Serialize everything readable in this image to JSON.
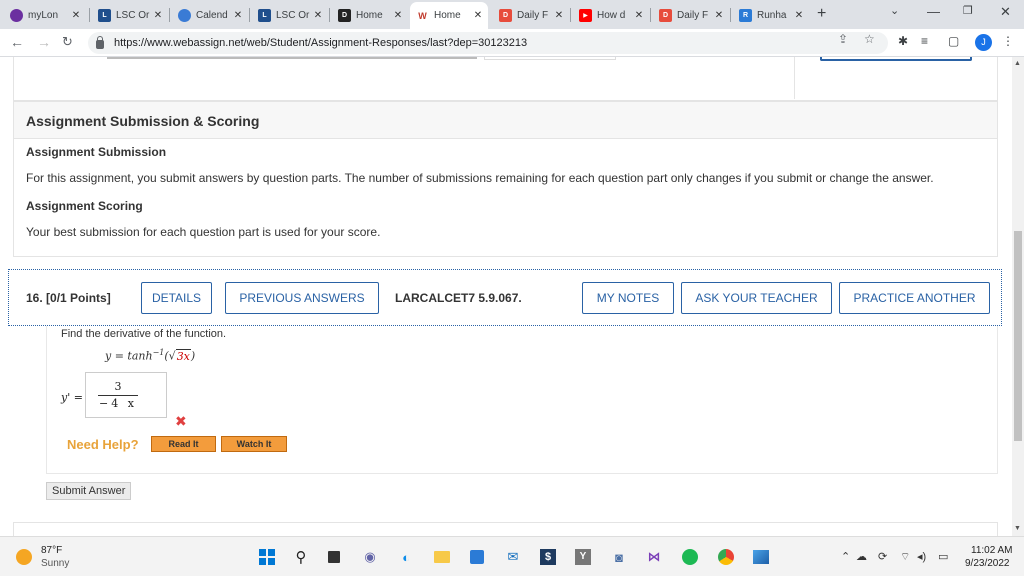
{
  "browser": {
    "tabs": [
      {
        "title": "myLon",
        "icon": "mylone-icon",
        "color": "#6b2fa0"
      },
      {
        "title": "LSC Or",
        "icon": "lsc-icon",
        "color": "#1f4e8c"
      },
      {
        "title": "Calend",
        "icon": "calendar-app-icon",
        "color": "#3a7bd5"
      },
      {
        "title": "LSC Or",
        "icon": "lsc-icon",
        "color": "#1f4e8c"
      },
      {
        "title": "Home",
        "icon": "d2l-icon",
        "color": "#222222"
      },
      {
        "title": "Home",
        "icon": "webassign-icon",
        "color": "#c0392b"
      },
      {
        "title": "Daily F",
        "icon": "daily-icon",
        "color": "#e74c3c"
      },
      {
        "title": "How d",
        "icon": "youtube-icon",
        "color": "#ff0000"
      },
      {
        "title": "Daily F",
        "icon": "daily-icon",
        "color": "#e74c3c"
      },
      {
        "title": "Runha",
        "icon": "runhaar-icon",
        "color": "#2b7bd6"
      }
    ],
    "new_tab": "+",
    "url": "https://www.webassign.net/web/Student/Assignment-Responses/last?dep=30123213",
    "profile_initial": "J"
  },
  "info": {
    "heading": "Assignment Submission & Scoring",
    "submission_title": "Assignment Submission",
    "submission_text": "For this assignment, you submit answers by question parts. The number of submissions remaining for each question part only changes if you submit or change the answer.",
    "scoring_title": "Assignment Scoring",
    "scoring_text": "Your best submission for each question part is used for your score."
  },
  "question": {
    "number": "16.",
    "points": "[0/1 Points]",
    "details_label": "DETAILS",
    "previous_answers_label": "PREVIOUS ANSWERS",
    "code": "LARCALCET7 5.9.067.",
    "my_notes_label": "MY NOTES",
    "ask_teacher_label": "ASK YOUR TEACHER",
    "practice_label": "PRACTICE ANOTHER",
    "prompt": "Find the derivative of the function.",
    "function_lhs": "y = tanh",
    "function_exp": "−1",
    "function_open": "(",
    "function_radicand": "3x",
    "function_close": ")",
    "answer_label": "y' =",
    "answer_numerator": "3",
    "answer_denominator": "−4  x",
    "result_mark": "✖",
    "need_help_label": "Need Help?",
    "read_it_label": "Read It",
    "watch_it_label": "Watch It",
    "submit_label": "Submit Answer"
  },
  "taskbar": {
    "temperature": "87°F",
    "condition": "Sunny",
    "time": "11:02 AM",
    "date": "9/23/2022"
  }
}
